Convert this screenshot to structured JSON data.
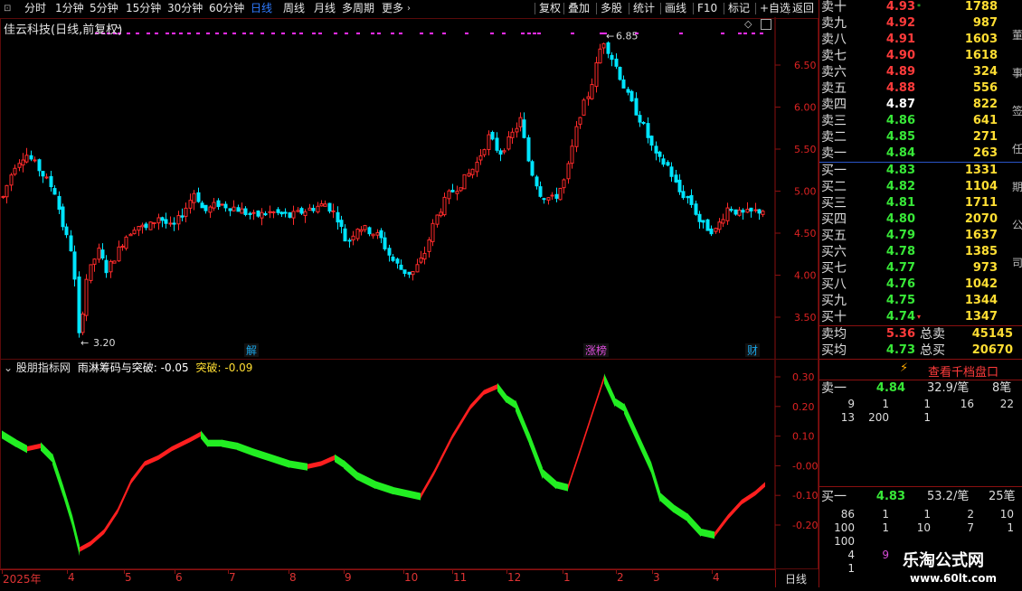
{
  "toolbar": {
    "periods": [
      "分时",
      "1分钟",
      "5分钟",
      "15分钟",
      "30分钟",
      "60分钟",
      "日线",
      "周线",
      "月线",
      "多周期",
      "更多"
    ],
    "active_period": "日线",
    "more_arrow": "›",
    "tools": [
      "复权",
      "叠加",
      "多股",
      "统计",
      "画线",
      "F10",
      "标记",
      "+自选",
      "返回"
    ]
  },
  "stock": {
    "title": "佳云科技(日线,前复权)",
    "high_label": "6.85",
    "low_label": "3.20",
    "events": [
      "解",
      "涨榜",
      "财"
    ],
    "price_ticks": [
      "6.50",
      "6.00",
      "5.50",
      "5.00",
      "4.50",
      "4.00",
      "3.50"
    ]
  },
  "indicator": {
    "source": "股朋指标网",
    "name": "雨淋筹码与突破",
    "value": ": -0.05",
    "break_label": "突破",
    "break_value": ": -0.09",
    "ticks": [
      "0.30",
      "0.20",
      "0.10",
      "-0.00",
      "-0.10",
      "-0.20"
    ]
  },
  "dates": {
    "labels": [
      "2025年",
      "4",
      "5",
      "6",
      "7",
      "8",
      "9",
      "10",
      "11",
      "12",
      "1",
      "2",
      "3",
      "4"
    ],
    "period_label": "日线"
  },
  "orderbook": {
    "asks": [
      {
        "label": "卖十",
        "price": "4.93",
        "vol": "1788",
        "color": "#ff3b3b",
        "mark": "*"
      },
      {
        "label": "卖九",
        "price": "4.92",
        "vol": "987",
        "color": "#ff3b3b",
        "mark": ""
      },
      {
        "label": "卖八",
        "price": "4.91",
        "vol": "1603",
        "color": "#ff3b3b",
        "mark": ""
      },
      {
        "label": "卖七",
        "price": "4.90",
        "vol": "1618",
        "color": "#ff3b3b",
        "mark": ""
      },
      {
        "label": "卖六",
        "price": "4.89",
        "vol": "324",
        "color": "#ff3b3b",
        "mark": ""
      },
      {
        "label": "卖五",
        "price": "4.88",
        "vol": "556",
        "color": "#ff3b3b",
        "mark": ""
      },
      {
        "label": "卖四",
        "price": "4.87",
        "vol": "822",
        "color": "#ffffff",
        "mark": ""
      },
      {
        "label": "卖三",
        "price": "4.86",
        "vol": "641",
        "color": "#38e838",
        "mark": ""
      },
      {
        "label": "卖二",
        "price": "4.85",
        "vol": "271",
        "color": "#38e838",
        "mark": ""
      },
      {
        "label": "卖一",
        "price": "4.84",
        "vol": "263",
        "color": "#38e838",
        "mark": ""
      }
    ],
    "bids": [
      {
        "label": "买一",
        "price": "4.83",
        "vol": "1331",
        "color": "#38e838",
        "mark": ""
      },
      {
        "label": "买二",
        "price": "4.82",
        "vol": "1104",
        "color": "#38e838",
        "mark": ""
      },
      {
        "label": "买三",
        "price": "4.81",
        "vol": "1711",
        "color": "#38e838",
        "mark": ""
      },
      {
        "label": "买四",
        "price": "4.80",
        "vol": "2070",
        "color": "#38e838",
        "mark": ""
      },
      {
        "label": "买五",
        "price": "4.79",
        "vol": "1637",
        "color": "#38e838",
        "mark": ""
      },
      {
        "label": "买六",
        "price": "4.78",
        "vol": "1385",
        "color": "#38e838",
        "mark": ""
      },
      {
        "label": "买七",
        "price": "4.77",
        "vol": "973",
        "color": "#38e838",
        "mark": ""
      },
      {
        "label": "买八",
        "price": "4.76",
        "vol": "1042",
        "color": "#38e838",
        "mark": ""
      },
      {
        "label": "买九",
        "price": "4.75",
        "vol": "1344",
        "color": "#38e838",
        "mark": ""
      },
      {
        "label": "买十",
        "price": "4.74",
        "vol": "1347",
        "color": "#38e838",
        "mark": "▾"
      }
    ],
    "avg_sell_label": "卖均",
    "avg_sell": "5.36",
    "total_sell_label": "总卖",
    "total_sell": "45145",
    "avg_buy_label": "买均",
    "avg_buy": "4.73",
    "total_buy_label": "总买",
    "total_buy": "20670",
    "view_ten_label": "查看千档盘口",
    "ask1_label": "卖一",
    "ask1_price": "4.84",
    "ask1_avg": "32.9/笔",
    "ask1_count": "8笔",
    "ask1_orders": [
      [
        "9",
        "1",
        "1",
        "16",
        "22"
      ],
      [
        "13",
        "200",
        "1",
        "",
        ""
      ]
    ],
    "bid1_label": "买一",
    "bid1_price": "4.83",
    "bid1_avg": "53.2/笔",
    "bid1_count": "25笔",
    "bid1_orders": [
      [
        "86",
        "1",
        "1",
        "2",
        "10"
      ],
      [
        "100",
        "1",
        "10",
        "7",
        "1"
      ],
      [
        "100",
        "",
        "",
        "",
        ""
      ],
      [
        "4",
        "9",
        "",
        "",
        ""
      ],
      [
        "1",
        "",
        "",
        "",
        ""
      ]
    ]
  },
  "right_edge_text": [
    "董",
    "事",
    "签",
    "任",
    "期",
    "公",
    "司"
  ],
  "watermark": {
    "name": "乐淘公式网",
    "url": "www.60lt.com"
  },
  "colors": {
    "up": "#ff2a2a",
    "down": "#00e5ff",
    "ind_up": "#ff1f1f",
    "ind_down": "#22ee22",
    "grid": "#8a1010",
    "magenta": "#ff2cff"
  }
}
